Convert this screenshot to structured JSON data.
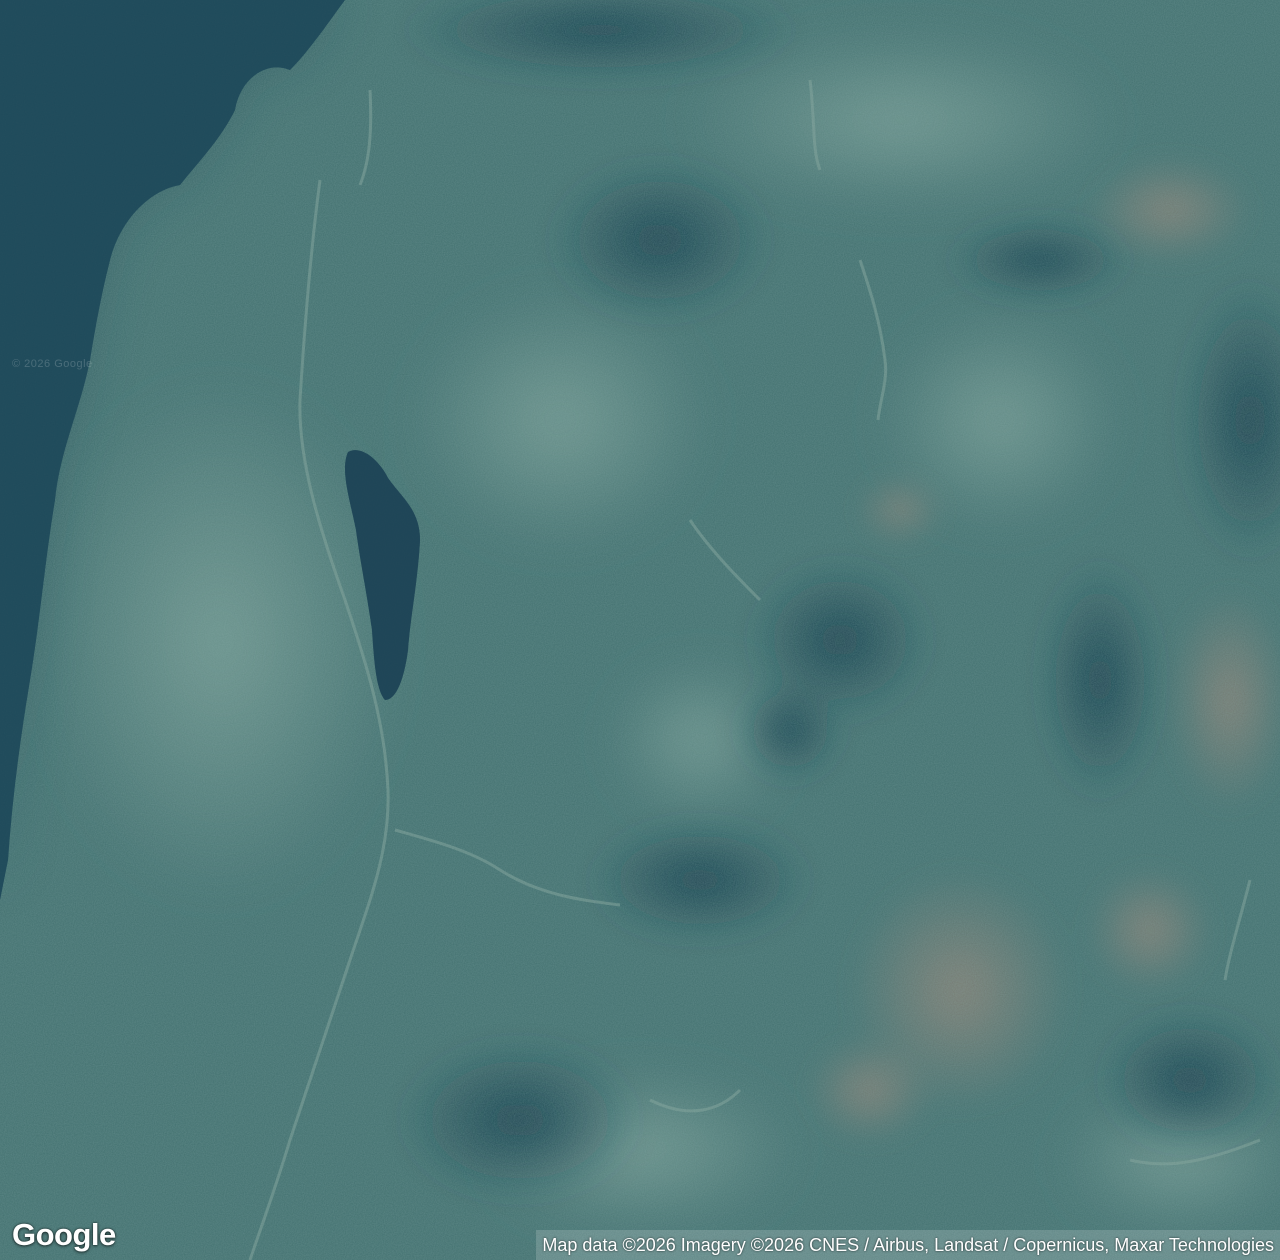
{
  "map": {
    "type": "satellite",
    "watermark": "© 2026 Google",
    "logo_text": "Google",
    "attribution": "Map data ©2026 Imagery ©2026 CNES / Airbus, Landsat / Copernicus, Maxar Technologies"
  },
  "colors": {
    "water": "#1f4a5a",
    "forest_dark": "#1f4b57",
    "forest_mid": "#3f6e70",
    "forest_light": "#5f8a83",
    "clearing": "#8a7d72",
    "logo": "#ffffff"
  },
  "icons": {
    "logo": "google-wordmark"
  }
}
